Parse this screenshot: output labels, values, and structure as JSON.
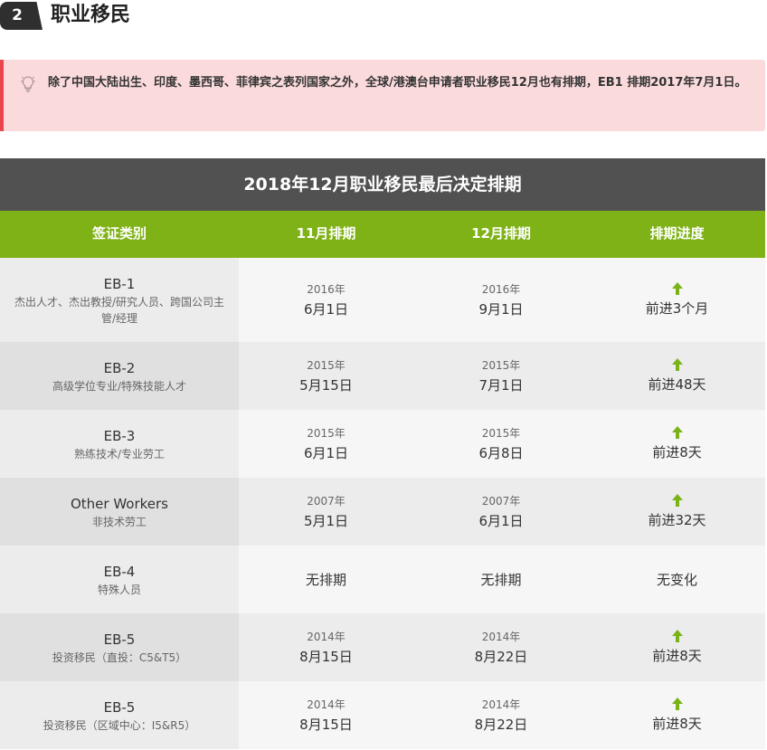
{
  "section": {
    "number": "2",
    "title": "职业移民"
  },
  "notice": {
    "icon": "lightbulb-icon",
    "text": "除了中国大陆出生、印度、墨西哥、菲律宾之表列国家之外，全球/港澳台申请者职业移民12月也有排期，EB1 排期2017年7月1日。"
  },
  "table": {
    "title": "2018年12月职业移民最后决定排期",
    "headers": [
      "签证类别",
      "11月排期",
      "12月排期",
      "排期进度"
    ],
    "rows": [
      {
        "name": "EB-1",
        "desc": "杰出人才、杰出教授/研究人员、跨国公司主管/经理",
        "nov_year": "2016年",
        "nov_date": "6月1日",
        "dec_year": "2016年",
        "dec_date": "9月1日",
        "progress": "前进3个月"
      },
      {
        "name": "EB-2",
        "desc": "高级学位专业/特殊技能人才",
        "nov_year": "2015年",
        "nov_date": "5月15日",
        "dec_year": "2015年",
        "dec_date": "7月1日",
        "progress": "前进48天"
      },
      {
        "name": "EB-3",
        "desc": "熟练技术/专业劳工",
        "nov_year": "2015年",
        "nov_date": "6月1日",
        "dec_year": "2015年",
        "dec_date": "6月8日",
        "progress": "前进8天"
      },
      {
        "name": "Other Workers",
        "desc": "非技术劳工",
        "nov_year": "2007年",
        "nov_date": "5月1日",
        "dec_year": "2007年",
        "dec_date": "6月1日",
        "progress": "前进32天"
      },
      {
        "name": "EB-4",
        "desc": "特殊人员",
        "nov_plain": "无排期",
        "dec_plain": "无排期",
        "progress_plain": "无变化"
      },
      {
        "name": "EB-5",
        "desc": "投资移民（直投：C5&T5）",
        "nov_year": "2014年",
        "nov_date": "8月15日",
        "dec_year": "2014年",
        "dec_date": "8月22日",
        "progress": "前进8天"
      },
      {
        "name": "EB-5",
        "desc": "投资移民（区域中心：I5&R5）",
        "nov_year": "2014年",
        "nov_date": "8月15日",
        "dec_year": "2014年",
        "dec_date": "8月22日",
        "progress": "前进8天"
      }
    ]
  },
  "colors": {
    "header_green": "#7fb217",
    "title_bar": "#515151",
    "notice_bg": "#fbdadc",
    "notice_border": "#e8454d",
    "arrow_green": "#7ab317"
  },
  "icons": {
    "up_arrow": "up-arrow-icon"
  }
}
